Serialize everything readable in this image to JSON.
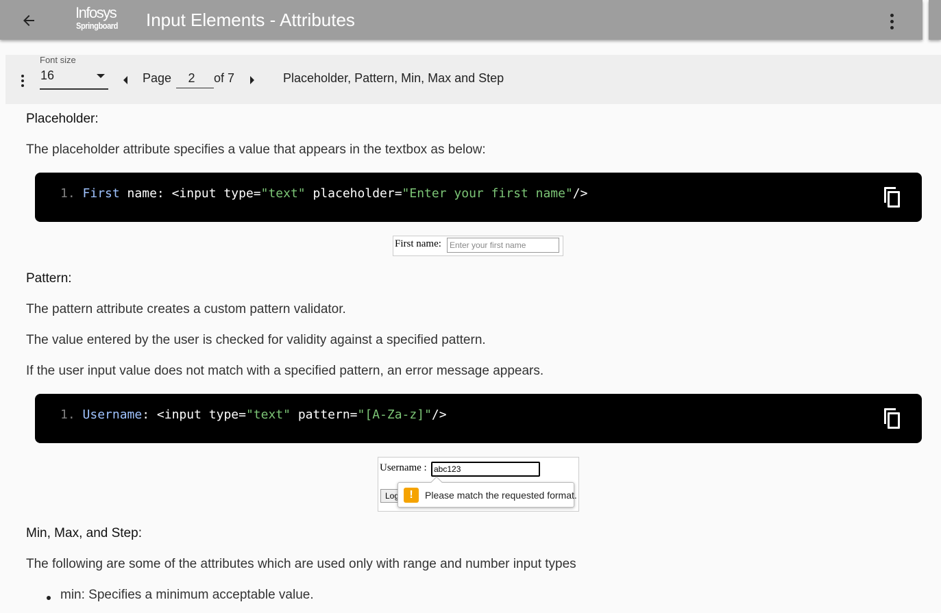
{
  "appbar": {
    "title": "Input Elements - Attributes",
    "logo_line1": "Infosys",
    "logo_line2": "Springboard",
    "back_icon": "arrow-left-icon",
    "more_icon": "more-vertical-icon"
  },
  "toolbar": {
    "font_size_label": "Font size",
    "font_size_value": "16",
    "page_label": "Page",
    "page_value": "2",
    "page_of": "of 7",
    "section_title": "Placeholder, Pattern, Min, Max and Step"
  },
  "content": {
    "placeholder_heading": "Placeholder:",
    "placeholder_desc": "The placeholder attribute specifies a value that appears in the textbox as below:",
    "code1": {
      "num": "1.",
      "p1": "First",
      "p2": " name: <input type=",
      "p3": "\"text\"",
      "p4": " placeholder=",
      "p5": "\"Enter your first name\"",
      "p6": "/>"
    },
    "demo1": {
      "label": "First name:",
      "placeholder": "Enter your first name"
    },
    "pattern_heading": "Pattern:",
    "pattern_p1": "The pattern attribute creates a custom pattern validator.",
    "pattern_p2": "The value entered by the user is checked for validity against a specified pattern.",
    "pattern_p3": "If the user input value does not match with a specified pattern, an error message appears.",
    "code2": {
      "num": "1.",
      "p1": "Username",
      "p2": ": <input type=",
      "p3": "\"text\"",
      "p4": " pattern=",
      "p5": "\"[A-Za-z]\"",
      "p6": "/>"
    },
    "demo2": {
      "label": "Username :",
      "value": "abc123",
      "button": "Log",
      "tooltip": "Please match the requested format."
    },
    "minmax_heading": "Min, Max, and Step:",
    "minmax_desc": "The following are some of the attributes which are used only with range and number input types",
    "bullets": [
      "min: Specifies a minimum acceptable value."
    ]
  }
}
